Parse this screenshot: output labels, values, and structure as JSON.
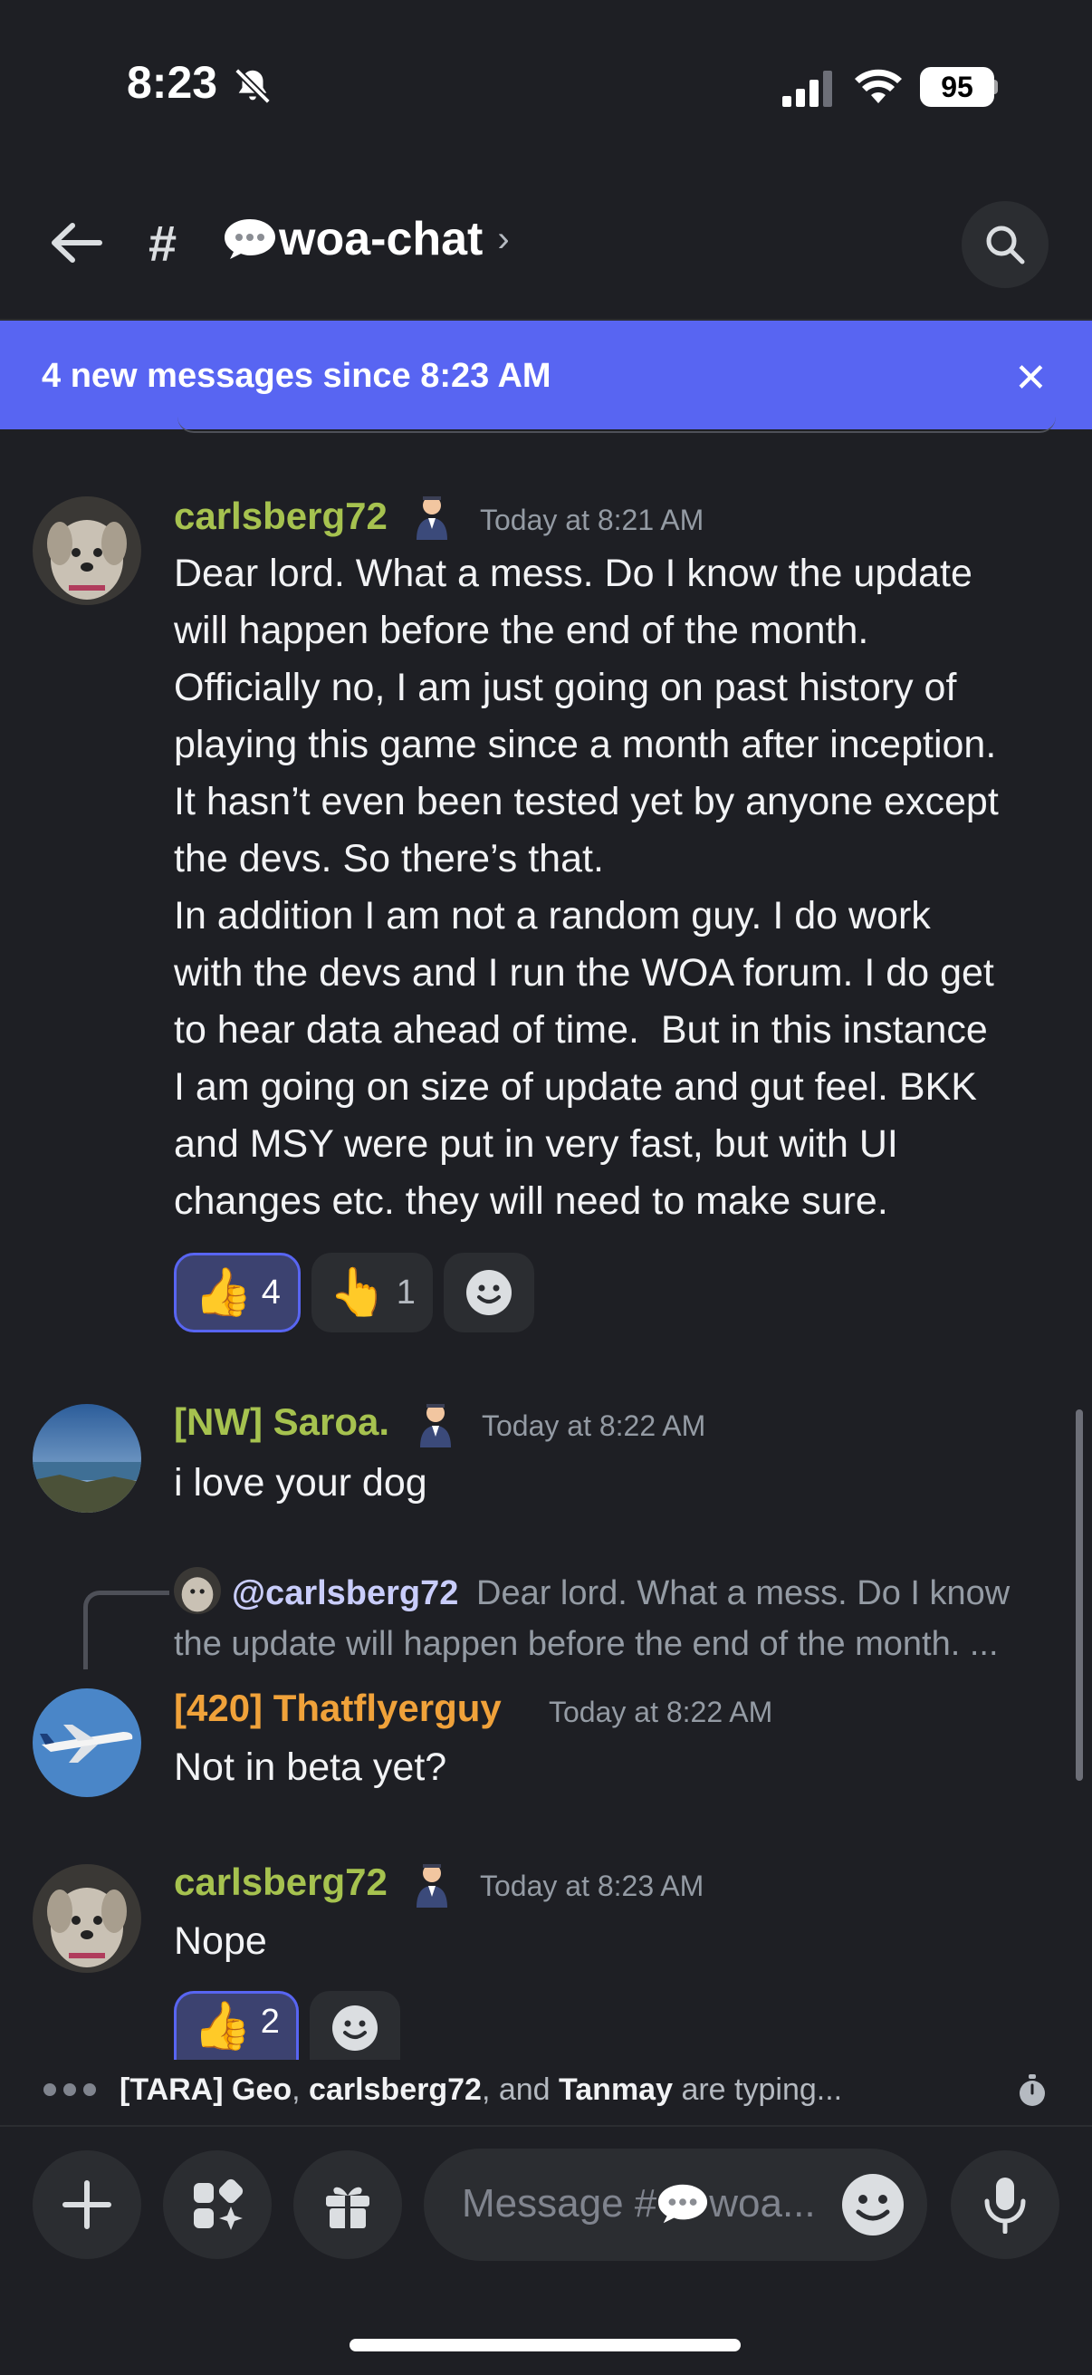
{
  "status_bar": {
    "time": "8:23",
    "battery": "95"
  },
  "header": {
    "channel_name": "woa-chat",
    "chevron": "›"
  },
  "banner": {
    "text": "4 new messages since 8:23 AM",
    "close": "✕"
  },
  "messages": [
    {
      "username": "carlsberg72",
      "timestamp": "Today at 8:21 AM",
      "text": "Dear lord. What a mess. Do I know the update\nwill happen before the end of the month.\nOfficially no, I am just going on past history of\nplaying this game since a month after inception.\nIt hasn’t even been tested yet by anyone except\nthe devs. So there’s that.\nIn addition I am not a random guy. I do work\nwith the devs and I run the WOA forum. I do get\nto hear data ahead of time.  But in this instance\nI am going on size of update and gut feel. BKK\nand MSY were put in very fast, but with UI\nchanges etc. they will need to make sure.",
      "reactions": [
        {
          "emoji": "👍",
          "count": "4",
          "active": true
        },
        {
          "emoji": "👆",
          "count": "1",
          "active": false
        }
      ]
    },
    {
      "username": "[NW] Saroa.",
      "timestamp": "Today at 8:22 AM",
      "text": "i love your dog"
    },
    {
      "reply": {
        "mention": "@carlsberg72",
        "preview_line1": "Dear lord. What a mess. Do I know",
        "preview_line2": "the update will happen before the end of the month. ..."
      },
      "username": "[420] Thatflyerguy",
      "timestamp": "Today at 8:22 AM",
      "text": "Not in beta yet?"
    },
    {
      "username": "carlsberg72",
      "timestamp": "Today at 8:23 AM",
      "text": "Nope",
      "reactions": [
        {
          "emoji": "👍",
          "count": "2",
          "active": true
        }
      ]
    }
  ],
  "typing": {
    "user1": "[TARA] Geo",
    "sep1": ", ",
    "user2": "carlsberg72",
    "sep2": ", and ",
    "user3": "Tanmay",
    "suffix": " are typing..."
  },
  "composer": {
    "placeholder_prefix": "Message #",
    "placeholder_suffix": "woa..."
  },
  "icons": {
    "bell_muted": "bell-slash-icon",
    "back": "arrow-left-icon",
    "search": "search-icon",
    "add": "plus-icon",
    "apps": "apps-icon",
    "gift": "gift-icon",
    "emoji": "smiley-icon",
    "mic": "microphone-icon",
    "timer": "stopwatch-icon"
  },
  "colors": {
    "accent": "#5865f2",
    "background": "#1e1f24",
    "username_green": "#a6c24f",
    "username_orange": "#f0a23a"
  }
}
